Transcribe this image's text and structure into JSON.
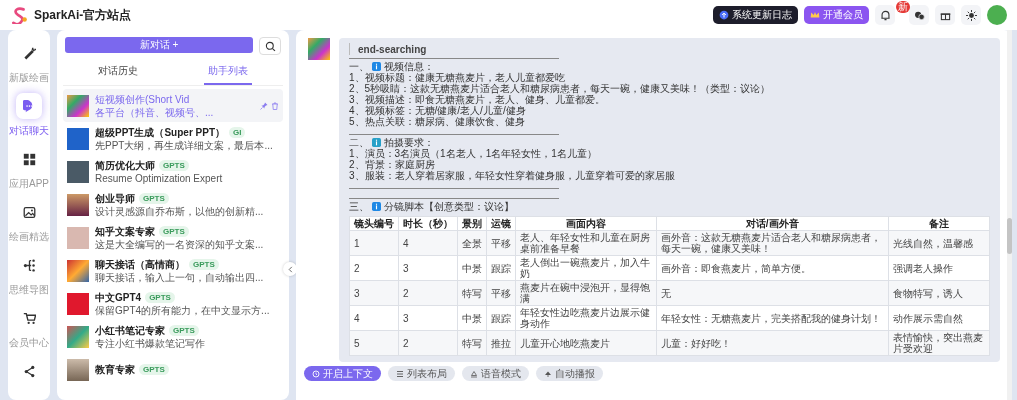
{
  "header": {
    "site_title": "SparkAi-官方站点",
    "buttons": [
      {
        "label": "系统更新日志",
        "kind": "dark"
      },
      {
        "label": "开通会员",
        "kind": "vip"
      }
    ],
    "notification_badge": "新"
  },
  "nav": [
    {
      "label": "新版绘画",
      "selected": false
    },
    {
      "label": "对话聊天",
      "selected": true
    },
    {
      "label": "应用APP",
      "selected": false
    },
    {
      "label": "绘画精选",
      "selected": false
    },
    {
      "label": "思维导图",
      "selected": false
    },
    {
      "label": "会员中心",
      "selected": false
    },
    {
      "selected": false
    }
  ],
  "sidebar": {
    "new_chat_button": "新对话 +",
    "tabs": [
      {
        "label": "对话历史",
        "selected": false
      },
      {
        "label": "助手列表",
        "selected": true
      }
    ],
    "assistants": [
      {
        "title": "短视频创作(Short Vid",
        "description": "各平台（抖音、视频号、...",
        "selected": true
      },
      {
        "title": "超级PPT生成（Super PPT）",
        "badge": "GI",
        "description": "先PPT大纲，再生成详细文案，最后本...",
        "selected": false
      },
      {
        "title": "简历优化大师",
        "badge": "GPTS",
        "description": "Resume Optimization Expert",
        "selected": false
      },
      {
        "title": "创业导师",
        "badge": "GPTS",
        "description": "设计灵感源自乔布斯，以他的创新精...",
        "selected": false
      },
      {
        "title": "知乎文案专家",
        "badge": "GPTS",
        "description": "这是大全编写的一名资深的知乎文案...",
        "selected": false
      },
      {
        "title": "聊天接话（高情商）",
        "badge": "GPTS",
        "description": "聊天接话，输入上一句，自动输出四...",
        "selected": false
      },
      {
        "title": "中文GPT4",
        "badge": "GPTS",
        "description": "保留GPT4的所有能力，在中文显示方...",
        "selected": false
      },
      {
        "title": "小红书笔记专家",
        "badge": "GPTS",
        "description": "专注小红书爆款笔记写作",
        "selected": false
      },
      {
        "title": "教育专家",
        "badge": "GPTS",
        "selected": false
      }
    ]
  },
  "message": {
    "tag": "end-searching",
    "sections": [
      {
        "number": "一、",
        "title": "视频信息：",
        "lines": [
          "1、视频标题：健康无糖燕麦片，老人儿童都爱吃",
          "2、5秒吸睛：这款无糖燕麦片适合老人和糖尿病患者，每天一碗，健康又美味！（类型：议论）",
          "3、视频描述：即食无糖燕麦片，老人、健身、儿童都爱。",
          "4、视频标签：无糖/健康/老人/儿童/健身",
          "5、热点关联：糖尿病、健康饮食、健身"
        ]
      },
      {
        "number": "二、",
        "title": "拍摄要求：",
        "lines": [
          "1、演员：3名演员（1名老人，1名年轻女性，1名儿童）",
          "2、背景：家庭厨房",
          "3、服装：老人穿着居家服，年轻女性穿着健身服，儿童穿着可爱的家居服"
        ]
      },
      {
        "number": "三、",
        "title": "分镜脚本【创意类型：议论】"
      }
    ],
    "table": {
      "columns": [
        "镜头编号",
        "时长（秒）",
        "景别",
        "运镜",
        "画面内容",
        "对话/画外音",
        "备注"
      ],
      "rows": [
        [
          "1",
          "4",
          "全景",
          "平移",
          "老人、年轻女性和儿童在厨房桌前准备早餐",
          "画外音：这款无糖燕麦片适合老人和糖尿病患者，每天一碗，健康又美味！",
          "光线自然，温馨感"
        ],
        [
          "2",
          "3",
          "中景",
          "跟踪",
          "老人倒出一碗燕麦片，加入牛奶",
          "画外音：即食燕麦片，简单方便。",
          "强调老人操作"
        ],
        [
          "3",
          "2",
          "特写",
          "平移",
          "燕麦片在碗中浸泡开，显得饱满",
          "无",
          "食物特写，诱人"
        ],
        [
          "4",
          "3",
          "中景",
          "跟踪",
          "年轻女性边吃燕麦片边展示健身动作",
          "年轻女性：无糖燕麦片，完美搭配我的健身计划！",
          "动作展示需自然"
        ],
        [
          "5",
          "2",
          "特写",
          "推拉",
          "儿童开心地吃燕麦片",
          "儿童：好好吃！",
          "表情愉快，突出燕麦片受欢迎"
        ]
      ]
    }
  },
  "toolbar": [
    {
      "label": "开启上下文",
      "selected": true
    },
    {
      "label": "列表布局",
      "selected": false
    },
    {
      "label": "语音模式",
      "selected": false
    },
    {
      "label": "自动播报",
      "selected": false
    }
  ]
}
